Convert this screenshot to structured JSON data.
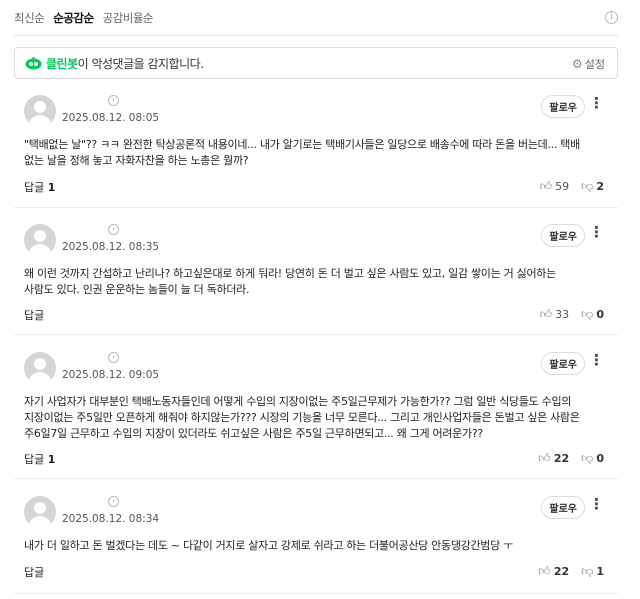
{
  "sort": {
    "tabs": [
      "최신순",
      "순공감순",
      "공감비율순"
    ],
    "active_index": 1
  },
  "cleanbot": {
    "name": "클린봇",
    "message": "이 악성댓글을 감지합니다.",
    "settings_label": "설정"
  },
  "comments": [
    {
      "date": "2025.08.12. 08:05",
      "follow_label": "팔로우",
      "text": "\"택배없는 날\"?? ㅋㅋ 완전한 탁상공론적 내용이네... 내가 알기로는 택배기사들은 일당으로 배송수에 따라 돈을 버는데... 택배 없는 날을 정해 놓고 자화자찬을 하는 노총은 뭘까?",
      "reply_label": "답글",
      "reply_count": "1",
      "likes": "59",
      "dislikes": "2"
    },
    {
      "date": "2025.08.12. 08:35",
      "follow_label": "팔로우",
      "text": "왜 이런 것까지 간섭하고 난리나? 하고싶은대로 하게 둬라! 당연히 돈 더 벌고 싶은 사람도 있고, 일감 쌓이는 거 싫어하는 사람도 있다. 인권 운운하는 놈들이 늘 더 독하더라.",
      "reply_label": "답글",
      "reply_count": "",
      "likes": "33",
      "dislikes": "0"
    },
    {
      "date": "2025.08.12. 09:05",
      "follow_label": "팔로우",
      "text": "자기 사업자가 대부분인 택배노동자들인데 어떻게 수입의 지장이없는 주5일근무제가 가능한가?? 그럼 일반 식당들도 수입의 지장이없는 주5일만 오픈하게 해줘야 하지않는가??? 시장의 기능을 너무 모른다... 그리고 개인사업자들은 돈벌고 싶은 사람은 주6일7일 근무하고 수입의 지장이 있더라도 쉬고싶은 사람은 주5일 근무하면되고... 왜 그게 어려운가??",
      "reply_label": "답글",
      "reply_count": "1",
      "likes": "22",
      "dislikes": "0"
    },
    {
      "date": "2025.08.12. 08:34",
      "follow_label": "팔로우",
      "text": "내가 더 일하고 돈 벌겠다는 데도 ~ 다같이 거지로 살자고 강제로 쉬라고 하는 더불어공산당 안동댕강간범당 ㅜ",
      "reply_label": "답글",
      "reply_count": "",
      "likes": "22",
      "dislikes": "1"
    }
  ]
}
